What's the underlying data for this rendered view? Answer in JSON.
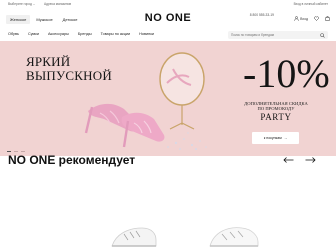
{
  "topbar": {
    "city": "Выберите город ⌄",
    "delivery": "Адреса магазинов",
    "phone": "8 800 555-33-19",
    "account": "Вход в личный кабинет"
  },
  "header": {
    "logo": "NO ONE",
    "gender_tabs": [
      {
        "label": "Женское",
        "active": true
      },
      {
        "label": "Мужское",
        "active": false
      },
      {
        "label": "Детское",
        "active": false
      }
    ],
    "login_label": "Вход"
  },
  "nav": {
    "items": [
      "Обувь",
      "Сумки",
      "Аксессуары",
      "Бренды",
      "Товары по акции",
      "Новинки"
    ],
    "search_placeholder": "Поиск по товарам и брендам"
  },
  "banner": {
    "headline_line1": "ЯРКИЙ",
    "headline_line2": "ВЫПУСКНОЙ",
    "discount": "-10%",
    "promo_line1": "дополнительная скидка",
    "promo_line2": "по промокоду",
    "promo_code": "PARTY",
    "cta": "к покупкам",
    "slide_count": 3,
    "active_slide": 1
  },
  "recommend": {
    "title": "NO ONE рекомендует"
  },
  "colors": {
    "banner_bg": "#f1d3d2",
    "accent_pink": "#e4a0b8",
    "text": "#111111"
  }
}
